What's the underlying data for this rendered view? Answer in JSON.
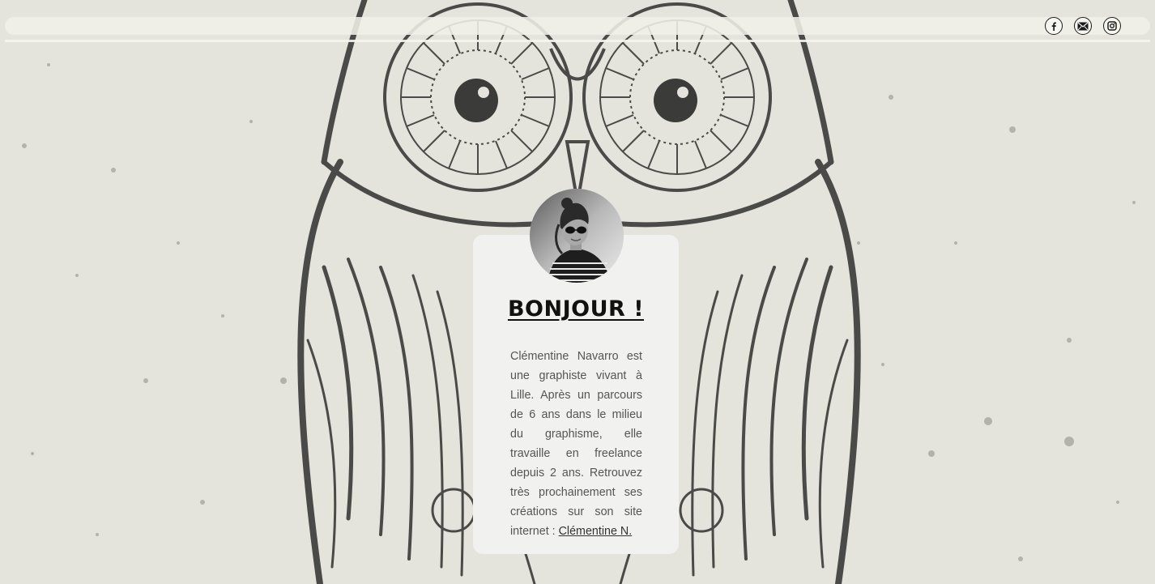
{
  "social": {
    "items": [
      {
        "name": "facebook",
        "icon": "facebook-icon"
      },
      {
        "name": "email",
        "icon": "envelope-icon"
      },
      {
        "name": "instagram",
        "icon": "instagram-icon"
      }
    ]
  },
  "card": {
    "title": "BONJOUR !",
    "bio_text": "Clémentine Navarro est une graphiste vivant à Lille. Après un parcours de 6 ans dans le milieu du graphisme, elle travaille en freelance depuis 2 ans. Retrouvez très prochainement ses créations sur son site internet : ",
    "link_text": "Clémentine N."
  },
  "colors": {
    "background": "#e4e4dc",
    "owl_ink": "#4a4a48",
    "card": "#f1f1f0",
    "title": "#111111",
    "body_text": "#555555"
  }
}
